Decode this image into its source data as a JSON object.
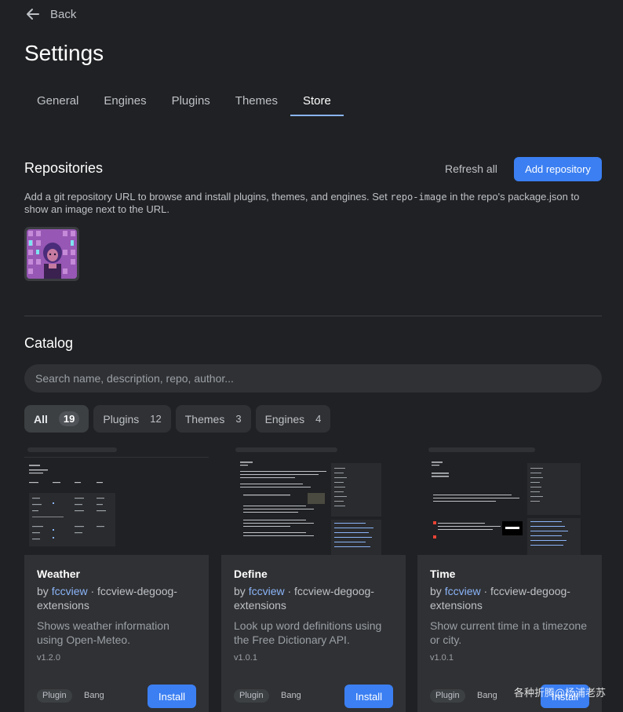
{
  "back": {
    "label": "Back"
  },
  "page": {
    "title": "Settings"
  },
  "tabs": [
    {
      "label": "General"
    },
    {
      "label": "Engines"
    },
    {
      "label": "Plugins"
    },
    {
      "label": "Themes"
    },
    {
      "label": "Store",
      "active": true
    }
  ],
  "repositories": {
    "title": "Repositories",
    "refresh_label": "Refresh all",
    "add_label": "Add repository",
    "description_before": "Add a git repository URL to browse and install plugins, themes, and engines. Set ",
    "description_code": "repo-image",
    "description_after": " in the repo's package.json to show an image next to the URL."
  },
  "catalog": {
    "title": "Catalog",
    "search_placeholder": "Search name, description, repo, author...",
    "filters": [
      {
        "label": "All",
        "count": "19",
        "active": true
      },
      {
        "label": "Plugins",
        "count": "12"
      },
      {
        "label": "Themes",
        "count": "3"
      },
      {
        "label": "Engines",
        "count": "4"
      }
    ],
    "cards": [
      {
        "name": "Weather",
        "by": "by ",
        "author": "fccview",
        "repo": " · fccview-degoog-extensions",
        "description": "Shows weather information using Open-Meteo.",
        "version": "v1.2.0",
        "type_tag": "Plugin",
        "kind_tag": "Bang",
        "install_label": "Install"
      },
      {
        "name": "Define",
        "by": "by ",
        "author": "fccview",
        "repo": " · fccview-degoog-extensions",
        "description": "Look up word definitions using the Free Dictionary API.",
        "version": "v1.0.1",
        "type_tag": "Plugin",
        "kind_tag": "Bang",
        "install_label": "Install"
      },
      {
        "name": "Time",
        "by": "by ",
        "author": "fccview",
        "repo": " · fccview-degoog-extensions",
        "description": "Show current time in a timezone or city.",
        "version": "v1.0.1",
        "type_tag": "Plugin",
        "kind_tag": "Bang",
        "install_label": "Install"
      }
    ]
  },
  "watermark": "各种折腾@杨浦老苏",
  "colors": {
    "accent": "#3b7ff2",
    "link": "#8ab4f8",
    "background": "#202124",
    "surface": "#303134"
  }
}
